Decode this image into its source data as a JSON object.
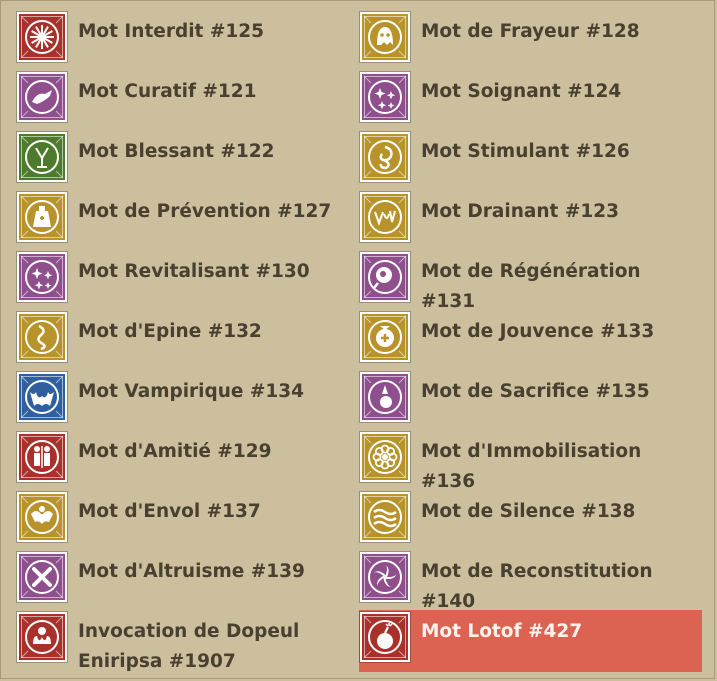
{
  "colors": {
    "background": "#cbbf9e",
    "text": "#4a4030",
    "selected_bg": "#dc6352",
    "selected_text": "#fff2ec",
    "red": "#a8322b",
    "purple": "#8f4e8c",
    "green": "#4d7a2d",
    "gold": "#b8922a",
    "blue": "#2f5f9e"
  },
  "left_column": [
    {
      "label": "Mot Interdit #125",
      "icon": "forbidden-star-icon",
      "color": "red"
    },
    {
      "label": "Mot Curatif #121",
      "icon": "curative-hand-icon",
      "color": "purple"
    },
    {
      "label": "Mot Blessant #122",
      "icon": "wounding-claw-icon",
      "color": "green"
    },
    {
      "label": "Mot de Prévention #127",
      "icon": "prevention-flask-icon",
      "color": "gold"
    },
    {
      "label": "Mot Revitalisant #130",
      "icon": "revitalizing-sparkles-icon",
      "color": "purple"
    },
    {
      "label": "Mot d'Epine #132",
      "icon": "thorn-icon",
      "color": "gold"
    },
    {
      "label": "Mot Vampirique #134",
      "icon": "vampire-bat-icon",
      "color": "blue"
    },
    {
      "label": "Mot d'Amitié #129",
      "icon": "friendship-figures-icon",
      "color": "red"
    },
    {
      "label": "Mot d'Envol #137",
      "icon": "flight-wings-icon",
      "color": "gold"
    },
    {
      "label": "Mot d'Altruisme #139",
      "icon": "altruism-cross-icon",
      "color": "purple"
    },
    {
      "label": "Invocation de Dopeul Eniripsa #1907",
      "icon": "dopeul-invocation-icon",
      "color": "red"
    }
  ],
  "right_column": [
    {
      "label": "Mot de Frayeur #128",
      "icon": "fright-ghost-icon",
      "color": "gold"
    },
    {
      "label": "Mot Soignant #124",
      "icon": "healing-sparkles-icon",
      "color": "purple"
    },
    {
      "label": "Mot Stimulant #126",
      "icon": "stimulating-spiral-icon",
      "color": "gold"
    },
    {
      "label": "Mot Drainant #123",
      "icon": "draining-icon",
      "color": "gold"
    },
    {
      "label": "Mot de Régénération #131",
      "icon": "regeneration-bubble-icon",
      "color": "purple"
    },
    {
      "label": "Mot de Jouvence #133",
      "icon": "youth-heart-icon",
      "color": "gold"
    },
    {
      "label": "Mot de Sacrifice #135",
      "icon": "sacrifice-dagger-icon",
      "color": "purple"
    },
    {
      "label": "Mot d'Immobilisation #136",
      "icon": "immobilization-flower-icon",
      "color": "gold"
    },
    {
      "label": "Mot de Silence #138",
      "icon": "silence-waves-icon",
      "color": "gold"
    },
    {
      "label": "Mot de Reconstitution #140",
      "icon": "reconstitution-swirl-icon",
      "color": "purple"
    },
    {
      "label": "Mot Lotof #427",
      "icon": "lotof-bomb-icon",
      "color": "red",
      "selected": true
    }
  ]
}
